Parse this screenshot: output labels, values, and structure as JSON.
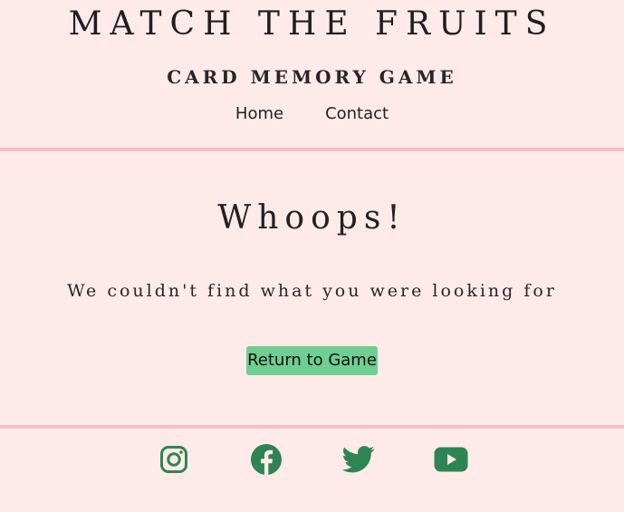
{
  "header": {
    "title": "MATCH THE FRUITS",
    "subtitle": "CARD MEMORY GAME",
    "nav": {
      "home_label": "Home",
      "contact_label": "Contact"
    }
  },
  "main": {
    "heading": "Whoops!",
    "message": "We couldn't find what you were looking for",
    "button_label": "Return to Game"
  },
  "footer": {
    "icons": [
      "instagram-icon",
      "facebook-icon",
      "twitter-icon",
      "youtube-icon"
    ],
    "icon_color": "#2e8553"
  },
  "colors": {
    "background": "#ffeaea",
    "divider": "#f7c0c4",
    "button": "#6fce91"
  }
}
